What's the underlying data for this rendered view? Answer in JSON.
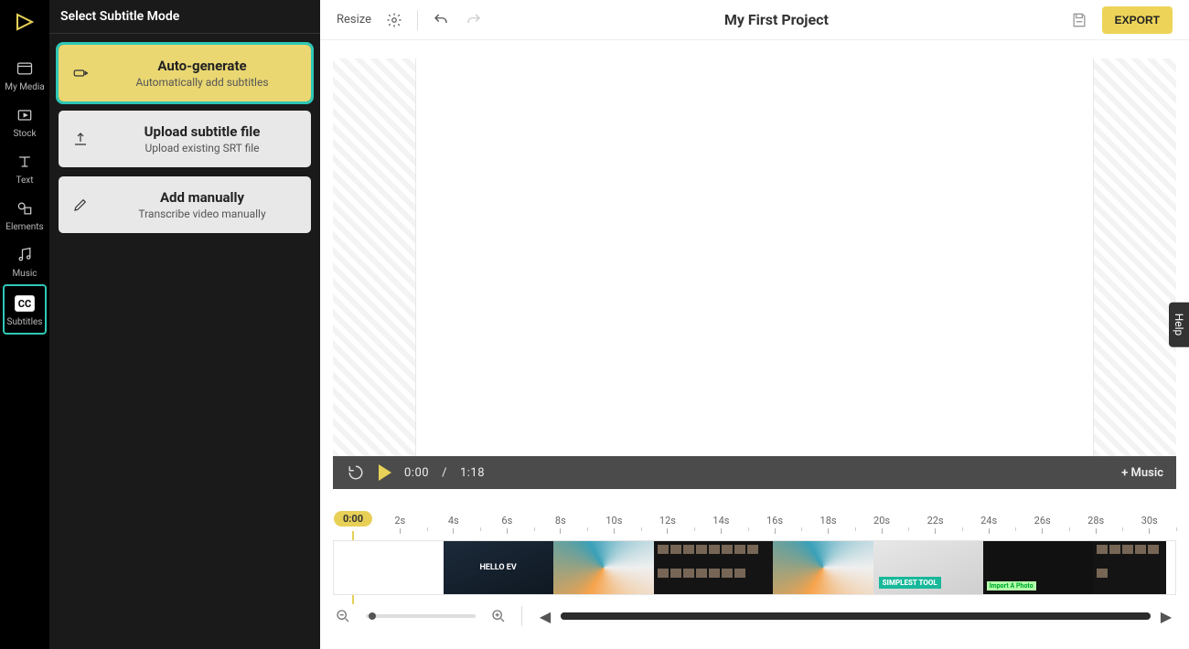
{
  "rail": {
    "items": [
      {
        "key": "my-media",
        "label": "My Media"
      },
      {
        "key": "stock",
        "label": "Stock"
      },
      {
        "key": "text",
        "label": "Text"
      },
      {
        "key": "elements",
        "label": "Elements"
      },
      {
        "key": "music",
        "label": "Music"
      },
      {
        "key": "subtitles",
        "label": "Subtitles"
      }
    ],
    "active": "subtitles"
  },
  "panel": {
    "title": "Select Subtitle Mode",
    "cards": [
      {
        "key": "auto",
        "title": "Auto-generate",
        "sub": "Automatically add subtitles"
      },
      {
        "key": "upload",
        "title": "Upload subtitle file",
        "sub": "Upload existing SRT file"
      },
      {
        "key": "manual",
        "title": "Add manually",
        "sub": "Transcribe video manually"
      }
    ],
    "selected": "auto"
  },
  "topbar": {
    "resize": "Resize",
    "project_title": "My First Project",
    "export": "EXPORT"
  },
  "playbar": {
    "current": "0:00",
    "separator": "/",
    "total": "1:18",
    "add_music": "+ Music"
  },
  "timeline": {
    "playhead_label": "0:00",
    "ticks": [
      "2s",
      "4s",
      "6s",
      "8s",
      "10s",
      "12s",
      "14s",
      "16s",
      "18s",
      "20s",
      "22s",
      "24s",
      "26s",
      "28s",
      "30s"
    ],
    "clip_labels": {
      "hello": "HELLO EV",
      "simplest": "SIMPLEST TOOL",
      "import": "Import A Photo"
    }
  },
  "help": "Help"
}
